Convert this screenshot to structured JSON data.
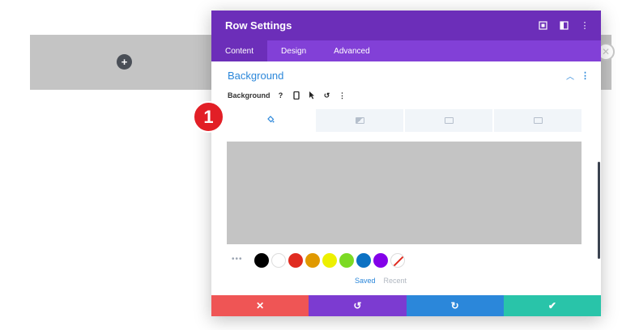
{
  "modal": {
    "title": "Row Settings",
    "tabs": [
      {
        "label": "Content"
      },
      {
        "label": "Design"
      },
      {
        "label": "Advanced"
      }
    ]
  },
  "section": {
    "title": "Background"
  },
  "field": {
    "label": "Background",
    "help_icon": "?"
  },
  "background_tabs": [
    {
      "name": "color",
      "icon": "paint-bucket-icon"
    },
    {
      "name": "gradient",
      "icon": "gradient-icon"
    },
    {
      "name": "image",
      "icon": "image-icon"
    },
    {
      "name": "video",
      "icon": "video-icon"
    }
  ],
  "swatches": {
    "colors": [
      "#000000",
      "#ffffff",
      "#e02b20",
      "#e09900",
      "#edf000",
      "#7cda24",
      "#0c71c3",
      "#8300e9"
    ],
    "saved_label": "Saved",
    "recent_label": "Recent"
  },
  "footer": {
    "buttons": [
      "cancel",
      "undo",
      "redo",
      "save"
    ]
  },
  "annotation": {
    "number": "1"
  },
  "colors": {
    "header": "#6c2eb9",
    "tabs": "#8240d7",
    "accent": "#2b87da",
    "cancel": "#ef5555",
    "undo": "#7c3bd1",
    "redo": "#2b87da",
    "save": "#29c4a9",
    "badge": "#e21f26"
  }
}
